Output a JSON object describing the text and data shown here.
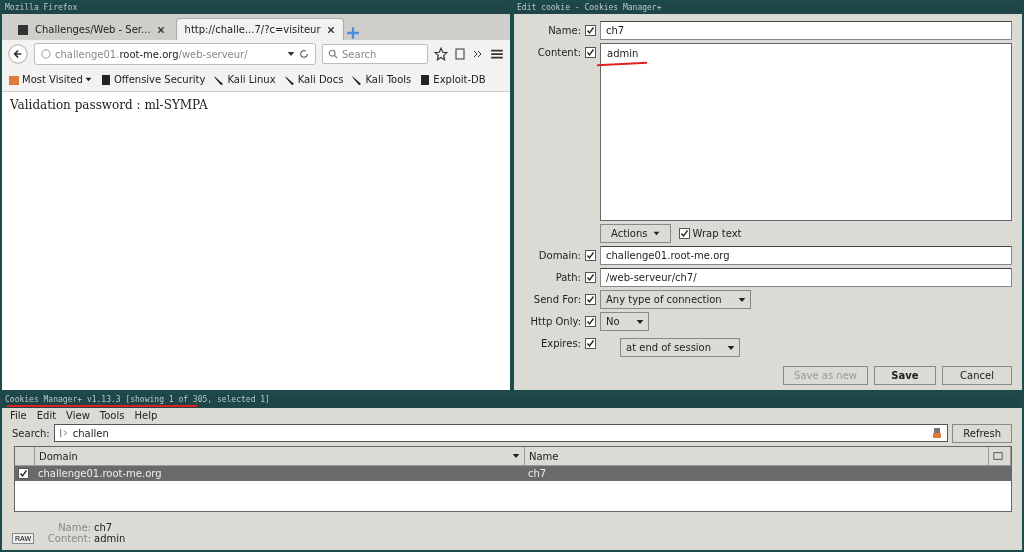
{
  "firefox": {
    "title": "Mozilla Firefox",
    "tabs": [
      {
        "label": "Challenges/Web - Ser...",
        "selected": false
      },
      {
        "label": "http://challe...7/?c=visiteur",
        "selected": true
      }
    ],
    "url": {
      "host_prefix": "challenge01.",
      "host": "root-me.org",
      "path": "/web-serveur/"
    },
    "search": {
      "placeholder": "Search"
    },
    "bookmarks": [
      {
        "label": "Most Visited",
        "kind": "folder"
      },
      {
        "label": "Offensive Security",
        "kind": "site"
      },
      {
        "label": "Kali Linux",
        "kind": "dragon"
      },
      {
        "label": "Kali Docs",
        "kind": "dragon"
      },
      {
        "label": "Kali Tools",
        "kind": "dragon"
      },
      {
        "label": "Exploit-DB",
        "kind": "site"
      }
    ],
    "content": "Validation password : ml-SYMPA"
  },
  "edit_cookie": {
    "title": "Edit cookie - Cookies Manager+",
    "name": {
      "label": "Name:",
      "checked": true,
      "value": "ch7"
    },
    "content": {
      "label": "Content:",
      "checked": true,
      "value": "admin"
    },
    "actions": "Actions",
    "wrap_text": {
      "label": "Wrap text",
      "checked": true
    },
    "fields": [
      {
        "label": "Domain:",
        "checked": true,
        "value": "challenge01.root-me.org",
        "kind": "text"
      },
      {
        "label": "Path:",
        "checked": true,
        "value": "/web-serveur/ch7/",
        "kind": "text"
      },
      {
        "label": "Send For:",
        "checked": true,
        "value": "Any type of connection",
        "kind": "select"
      },
      {
        "label": "Http Only:",
        "checked": true,
        "value": "No",
        "kind": "select"
      },
      {
        "label": "Expires:",
        "checked": true,
        "value": "at end of session",
        "kind": "select"
      }
    ],
    "buttons": [
      {
        "label": "Save as new",
        "disabled": true
      },
      {
        "label": "Save",
        "disabled": false
      },
      {
        "label": "Cancel",
        "disabled": false
      }
    ]
  },
  "cookies_manager": {
    "title": "Cookies Manager+ v1.13.3 [showing 1 of 305, selected 1]",
    "menu": [
      "File",
      "Edit",
      "View",
      "Tools",
      "Help"
    ],
    "search_label": "Search:",
    "search_value": "challen",
    "refresh": "Refresh",
    "columns": [
      "Domain",
      "Name"
    ],
    "rows": [
      {
        "domain": "challenge01.root-me.org",
        "name": "ch7",
        "checked": true,
        "selected": true
      }
    ],
    "details": [
      {
        "label": "Name:",
        "value": "ch7"
      },
      {
        "label": "Content:",
        "value": "admin"
      }
    ],
    "raw": "RAW"
  }
}
